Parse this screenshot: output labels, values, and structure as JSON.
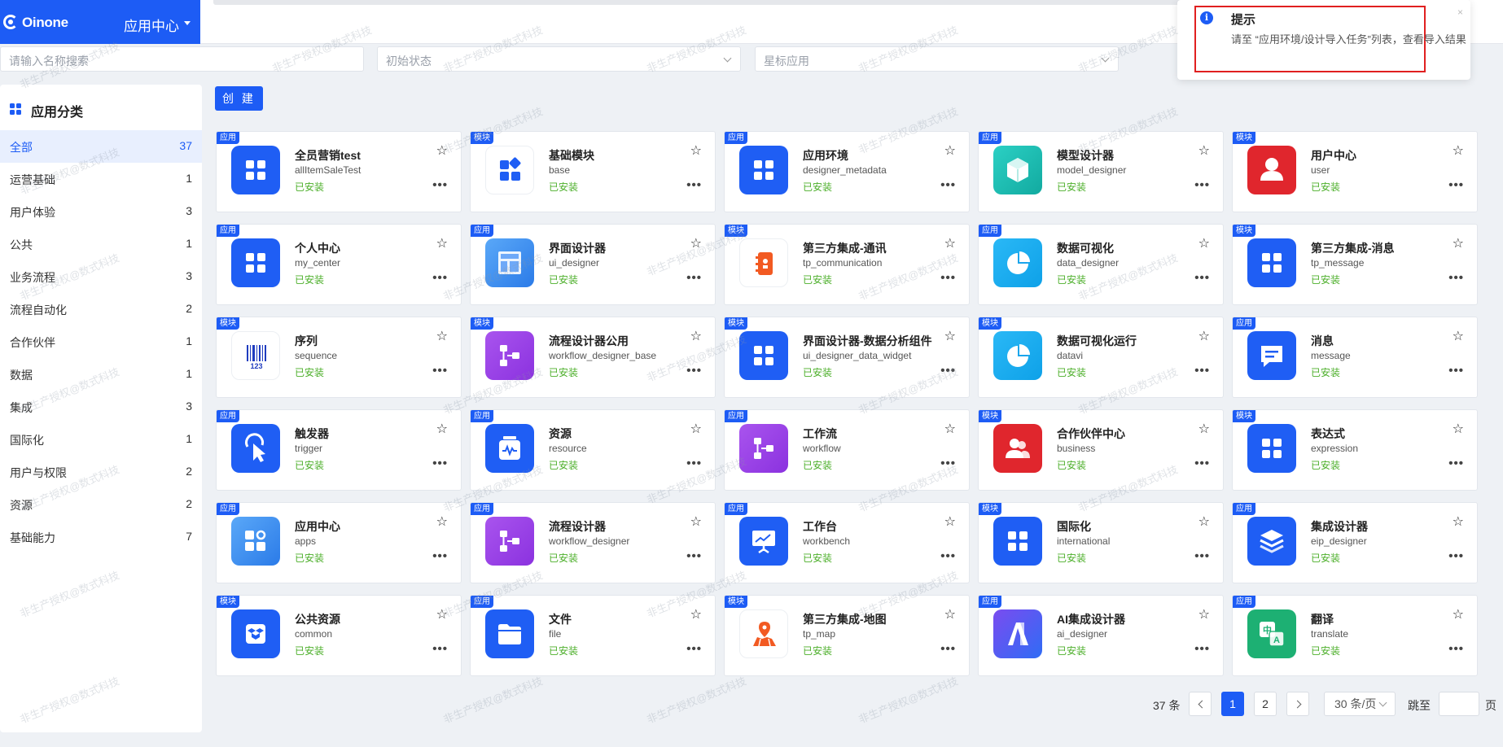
{
  "header": {
    "brand": "Oinone",
    "app_center": "应用中心"
  },
  "filters": {
    "name_placeholder": "请输入名称搜索",
    "status_placeholder": "初始状态",
    "star_placeholder": "星标应用"
  },
  "sidebar": {
    "title": "应用分类",
    "items": [
      {
        "label": "全部",
        "count": "37"
      },
      {
        "label": "运营基础",
        "count": "1"
      },
      {
        "label": "用户体验",
        "count": "3"
      },
      {
        "label": "公共",
        "count": "1"
      },
      {
        "label": "业务流程",
        "count": "3"
      },
      {
        "label": "流程自动化",
        "count": "2"
      },
      {
        "label": "合作伙伴",
        "count": "1"
      },
      {
        "label": "数据",
        "count": "1"
      },
      {
        "label": "集成",
        "count": "3"
      },
      {
        "label": "国际化",
        "count": "1"
      },
      {
        "label": "用户与权限",
        "count": "2"
      },
      {
        "label": "资源",
        "count": "2"
      },
      {
        "label": "基础能力",
        "count": "7"
      }
    ]
  },
  "toolbar": {
    "create_label": "创 建"
  },
  "icons": {
    "star": "☆",
    "more": "•••",
    "info": "i",
    "close": "×"
  },
  "apps": [
    {
      "badge": "应用",
      "name": "全员营销test",
      "code": "allItemSaleTest",
      "status": "已安装",
      "icon": "grid-icon",
      "bg": "blue"
    },
    {
      "badge": "模块",
      "name": "基础模块",
      "code": "base",
      "status": "已安装",
      "icon": "base-module-icon",
      "bg": "white"
    },
    {
      "badge": "应用",
      "name": "应用环境",
      "code": "designer_metadata",
      "status": "已安装",
      "icon": "grid-icon",
      "bg": "blue"
    },
    {
      "badge": "应用",
      "name": "模型设计器",
      "code": "model_designer",
      "status": "已安装",
      "icon": "cube-icon",
      "bg": "teal"
    },
    {
      "badge": "模块",
      "name": "用户中心",
      "code": "user",
      "status": "已安装",
      "icon": "user-icon",
      "bg": "red"
    },
    {
      "badge": "应用",
      "name": "个人中心",
      "code": "my_center",
      "status": "已安装",
      "icon": "grid-icon",
      "bg": "blue"
    },
    {
      "badge": "应用",
      "name": "界面设计器",
      "code": "ui_designer",
      "status": "已安装",
      "icon": "layout-icon",
      "bg": "gblue"
    },
    {
      "badge": "模块",
      "name": "第三方集成-通讯",
      "code": "tp_communication",
      "status": "已安装",
      "icon": "address-book-icon",
      "bg": "white"
    },
    {
      "badge": "应用",
      "name": "数据可视化",
      "code": "data_designer",
      "status": "已安装",
      "icon": "pie-chart-icon",
      "bg": "cyan"
    },
    {
      "badge": "模块",
      "name": "第三方集成-消息",
      "code": "tp_message",
      "status": "已安装",
      "icon": "grid-icon",
      "bg": "blue"
    },
    {
      "badge": "模块",
      "name": "序列",
      "code": "sequence",
      "status": "已安装",
      "icon": "barcode-icon",
      "bg": "white"
    },
    {
      "badge": "模块",
      "name": "流程设计器公用",
      "code": "workflow_designer_base",
      "status": "已安装",
      "icon": "workflow-icon",
      "bg": "purple"
    },
    {
      "badge": "模块",
      "name": "界面设计器-数据分析组件",
      "code": "ui_designer_data_widget",
      "status": "已安装",
      "icon": "grid-icon",
      "bg": "blue"
    },
    {
      "badge": "模块",
      "name": "数据可视化运行",
      "code": "datavi",
      "status": "已安装",
      "icon": "pie-chart-icon",
      "bg": "cyan"
    },
    {
      "badge": "应用",
      "name": "消息",
      "code": "message",
      "status": "已安装",
      "icon": "message-icon",
      "bg": "blue"
    },
    {
      "badge": "应用",
      "name": "触发器",
      "code": "trigger",
      "status": "已安装",
      "icon": "cursor-click-icon",
      "bg": "blue"
    },
    {
      "badge": "应用",
      "name": "资源",
      "code": "resource",
      "status": "已安装",
      "icon": "resource-icon",
      "bg": "blue"
    },
    {
      "badge": "应用",
      "name": "工作流",
      "code": "workflow",
      "status": "已安装",
      "icon": "workflow-icon",
      "bg": "purple"
    },
    {
      "badge": "模块",
      "name": "合作伙伴中心",
      "code": "business",
      "status": "已安装",
      "icon": "partners-icon",
      "bg": "red"
    },
    {
      "badge": "模块",
      "name": "表达式",
      "code": "expression",
      "status": "已安装",
      "icon": "grid-icon",
      "bg": "blue"
    },
    {
      "badge": "应用",
      "name": "应用中心",
      "code": "apps",
      "status": "已安装",
      "icon": "apps-gear-icon",
      "bg": "gblue"
    },
    {
      "badge": "应用",
      "name": "流程设计器",
      "code": "workflow_designer",
      "status": "已安装",
      "icon": "workflow-icon",
      "bg": "purple"
    },
    {
      "badge": "应用",
      "name": "工作台",
      "code": "workbench",
      "status": "已安装",
      "icon": "presentation-icon",
      "bg": "blue"
    },
    {
      "badge": "模块",
      "name": "国际化",
      "code": "international",
      "status": "已安装",
      "icon": "grid-icon",
      "bg": "blue"
    },
    {
      "badge": "应用",
      "name": "集成设计器",
      "code": "eip_designer",
      "status": "已安装",
      "icon": "layers-icon",
      "bg": "blue"
    },
    {
      "badge": "模块",
      "name": "公共资源",
      "code": "common",
      "status": "已安装",
      "icon": "dropbox-icon",
      "bg": "blue"
    },
    {
      "badge": "应用",
      "name": "文件",
      "code": "file",
      "status": "已安装",
      "icon": "folder-icon",
      "bg": "blue"
    },
    {
      "badge": "模块",
      "name": "第三方集成-地图",
      "code": "tp_map",
      "status": "已安装",
      "icon": "map-pin-icon",
      "bg": "white"
    },
    {
      "badge": "应用",
      "name": "AI集成设计器",
      "code": "ai_designer",
      "status": "已安装",
      "icon": "ai-icon",
      "bg": "ai"
    },
    {
      "badge": "应用",
      "name": "翻译",
      "code": "translate",
      "status": "已安装",
      "icon": "translate-icon",
      "bg": "green"
    }
  ],
  "pagination": {
    "total": "37 条",
    "pages": [
      "1",
      "2"
    ],
    "page_size": "30 条/页",
    "jump_label": "跳至",
    "page_suffix": "页"
  },
  "toast": {
    "title": "提示",
    "message": "请至 “应用环境/设计导入任务”列表，查看导入结果"
  },
  "watermark": "非生产授权@数式科技"
}
